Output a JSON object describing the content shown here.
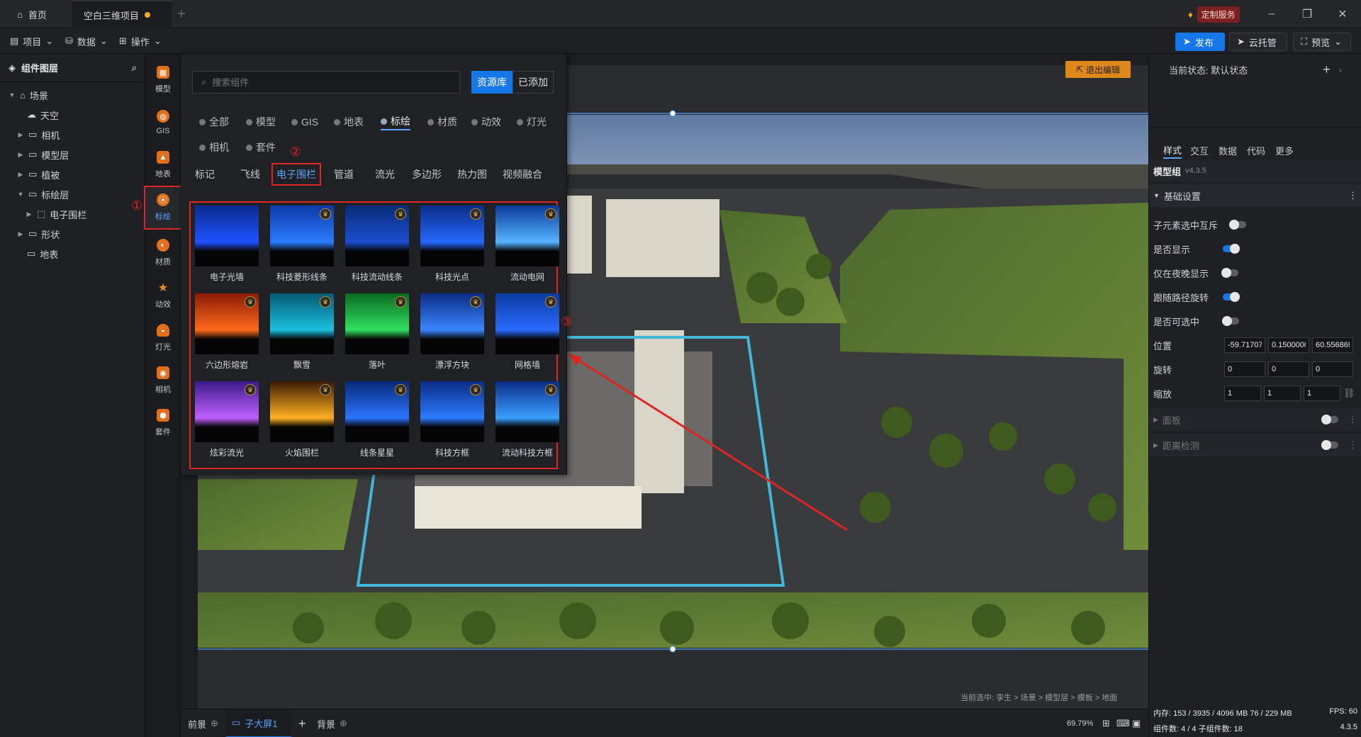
{
  "tabs": {
    "home": "首页",
    "project": "空白三维项目"
  },
  "custom_service": "定制服务",
  "menu": {
    "project": "项目",
    "data": "数据",
    "ops": "操作"
  },
  "toolbar": {
    "publish": "发布",
    "cloud": "云托管",
    "preview": "预览"
  },
  "tree": {
    "title": "组件图层",
    "items": [
      "场景",
      "天空",
      "相机",
      "模型层",
      "植被",
      "标绘层",
      "电子围栏",
      "形状",
      "地表"
    ]
  },
  "iconbar": [
    "模型",
    "GIS",
    "地表",
    "标绘",
    "材质",
    "动效",
    "灯光",
    "相机",
    "套件"
  ],
  "panel": {
    "search_placeholder": "搜索组件",
    "source_lib": "资源库",
    "added": "已添加",
    "categories": [
      "全部",
      "模型",
      "GIS",
      "地表",
      "标绘",
      "材质",
      "动效",
      "灯光",
      "相机",
      "套件"
    ],
    "subtabs": [
      "标记",
      "飞线",
      "电子围栏",
      "管道",
      "流光",
      "多边形",
      "热力图",
      "视频融合"
    ],
    "cards": [
      {
        "name": "电子光墙",
        "premium": false,
        "c1": "#0a2a8f",
        "c2": "#1e52ff"
      },
      {
        "name": "科技菱形线条",
        "premium": true,
        "c1": "#0d3aa8",
        "c2": "#2a7bff"
      },
      {
        "name": "科技流动线条",
        "premium": true,
        "c1": "#082a78",
        "c2": "#1b4fd0"
      },
      {
        "name": "科技光点",
        "premium": true,
        "c1": "#0a2c86",
        "c2": "#2468ff"
      },
      {
        "name": "流动电网",
        "premium": true,
        "c1": "#0a3a9a",
        "c2": "#56b5ff"
      },
      {
        "name": "六边形熔岩",
        "premium": true,
        "c1": "#8a1a05",
        "c2": "#ff6a1a"
      },
      {
        "name": "飘雪",
        "premium": true,
        "c1": "#065a73",
        "c2": "#1ac0e0"
      },
      {
        "name": "落叶",
        "premium": true,
        "c1": "#0a6a20",
        "c2": "#30e060"
      },
      {
        "name": "漂浮方块",
        "premium": true,
        "c1": "#0a2c86",
        "c2": "#3a86ff"
      },
      {
        "name": "网格墙",
        "premium": true,
        "c1": "#0a3aa0",
        "c2": "#2a6cff"
      },
      {
        "name": "炫彩流光",
        "premium": true,
        "c1": "#3a1a8a",
        "c2": "#c060ff"
      },
      {
        "name": "火焰围栏",
        "premium": true,
        "c1": "#3a1a05",
        "c2": "#ffb020"
      },
      {
        "name": "线条星星",
        "premium": true,
        "c1": "#082a78",
        "c2": "#2a74ff"
      },
      {
        "name": "科技方框",
        "premium": true,
        "c1": "#0a2c86",
        "c2": "#2b7bff"
      },
      {
        "name": "流动科技方框",
        "premium": true,
        "c1": "#0a2c86",
        "c2": "#3aa0ff"
      }
    ],
    "markers": [
      "①",
      "②",
      "③"
    ]
  },
  "viewport": {
    "exit_edit": "退出编辑",
    "selection_path": "当前选中: 孪生 > 场景 > 模型层 > 模板 > 地面"
  },
  "bottom": {
    "front": "前景",
    "sub": "子大屏1",
    "back": "背景",
    "zoom": "69.79%"
  },
  "right": {
    "state_label": "当前状态:  默认状态",
    "tabs": [
      "样式",
      "交互",
      "数据",
      "代码",
      "更多"
    ],
    "group_title": "模型组",
    "version": "v4.3.5",
    "section": "基础设置",
    "rows": [
      {
        "label": "子元素选中互斥",
        "on": false
      },
      {
        "label": "是否显示",
        "on": true
      },
      {
        "label": "仅在夜晚显示",
        "on": false
      },
      {
        "label": "跟随路径旋转",
        "on": true
      },
      {
        "label": "是否可选中",
        "on": false
      }
    ],
    "position_label": "位置",
    "position": [
      "-59.717079",
      "0.1500000",
      "60.556869"
    ],
    "rotation_label": "旋转",
    "rotation": [
      "0",
      "0",
      "0"
    ],
    "scale_label": "缩放",
    "scale": [
      "1",
      "1",
      "1"
    ],
    "panel_section": "面板",
    "distance_section": "距离检测",
    "stats1": "内存: 153 / 3935 / 4096 MB   76 / 229 MB",
    "fps": "FPS: 60",
    "stats2": "组件数: 4 / 4    子组件数: 18",
    "build": "4.3.5"
  }
}
